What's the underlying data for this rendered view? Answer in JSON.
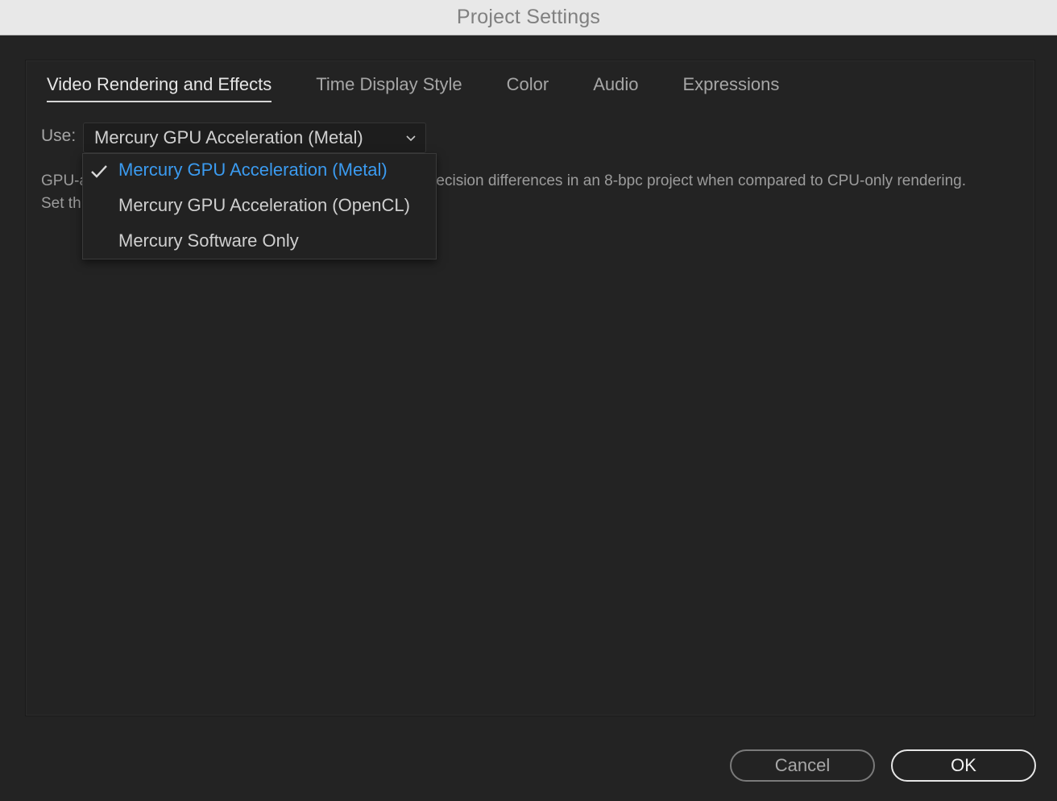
{
  "window": {
    "title": "Project Settings"
  },
  "tabs": [
    {
      "label": "Video Rendering and Effects",
      "active": true
    },
    {
      "label": "Time Display Style",
      "active": false
    },
    {
      "label": "Color",
      "active": false
    },
    {
      "label": "Audio",
      "active": false
    },
    {
      "label": "Expressions",
      "active": false
    }
  ],
  "renderer": {
    "use_label": "Use:",
    "selected_value": "Mercury GPU Acceleration (Metal)",
    "options": [
      {
        "label": "Mercury GPU Acceleration (Metal)",
        "checked": true
      },
      {
        "label": "Mercury GPU Acceleration (OpenCL)",
        "checked": false
      },
      {
        "label": "Mercury Software Only",
        "checked": false
      }
    ]
  },
  "description": {
    "line1_start": "GPU-a",
    "line1_end": "recision differences in an 8-bpc project when compared to CPU-only rendering.",
    "line2_start": "Set th"
  },
  "buttons": {
    "cancel": "Cancel",
    "ok": "OK"
  },
  "colors": {
    "background": "#232323",
    "titlebar": "#e8e8e8",
    "accent": "#3b9bf0"
  },
  "icons": {
    "dropdown": "chevron-down-icon",
    "selected": "checkmark-icon"
  }
}
